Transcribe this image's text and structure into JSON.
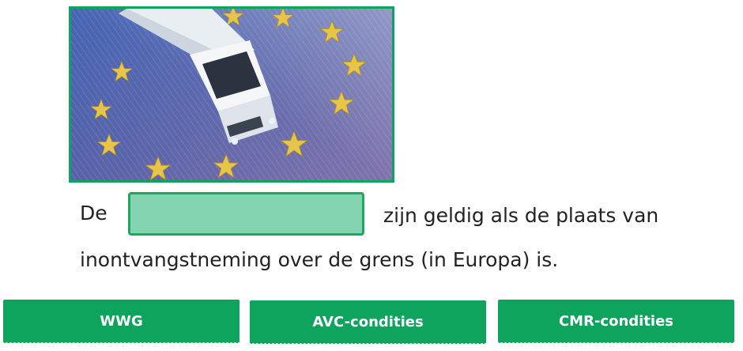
{
  "question": {
    "word_before_gap": "De",
    "text_after_gap": "zijn geldig als de plaats van",
    "second_line": "inontvangstneming over de grens (in Europa) is."
  },
  "drop_zone": {
    "value": ""
  },
  "options": [
    {
      "label": "WWG"
    },
    {
      "label": "AVC-condities"
    },
    {
      "label": "CMR-condities"
    }
  ],
  "colors": {
    "accent": "#0fa45d",
    "drop_zone_fill": "#83d4b1",
    "flag_blue": "#2f4aa0",
    "star_gold": "#f0c419"
  },
  "image": {
    "icon": "truck-on-eu-flag-photo"
  }
}
